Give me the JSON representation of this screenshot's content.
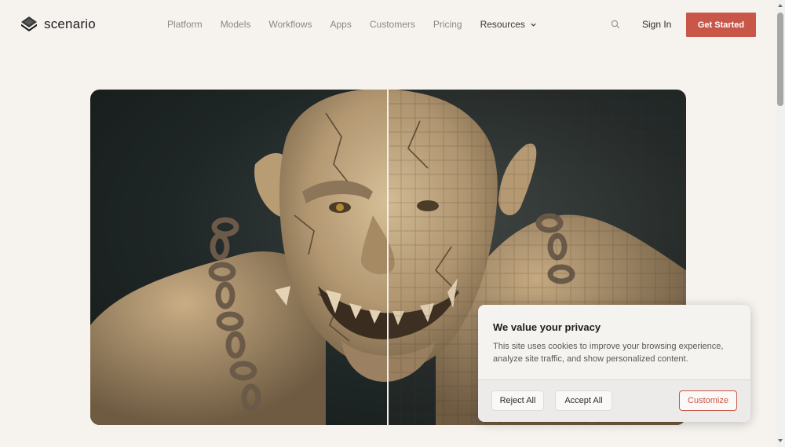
{
  "brand": {
    "name": "scenario",
    "logo_icon": "layered-diamond-icon"
  },
  "nav": {
    "items": [
      {
        "label": "Platform"
      },
      {
        "label": "Models"
      },
      {
        "label": "Workflows"
      },
      {
        "label": "Apps"
      },
      {
        "label": "Customers"
      },
      {
        "label": "Pricing"
      },
      {
        "label": "Resources"
      }
    ]
  },
  "header": {
    "search_icon": "search-icon",
    "signin_label": "Sign In",
    "cta_label": "Get Started",
    "cta_color": "#c8574a"
  },
  "hero": {
    "left_half": "detailed",
    "right_half": "pixelated"
  },
  "cookie": {
    "title": "We value your privacy",
    "text": "This site uses cookies to improve your browsing experience, analyze site traffic, and show personalized content.",
    "reject_label": "Reject All",
    "accept_label": "Accept All",
    "customize_label": "Customize"
  }
}
